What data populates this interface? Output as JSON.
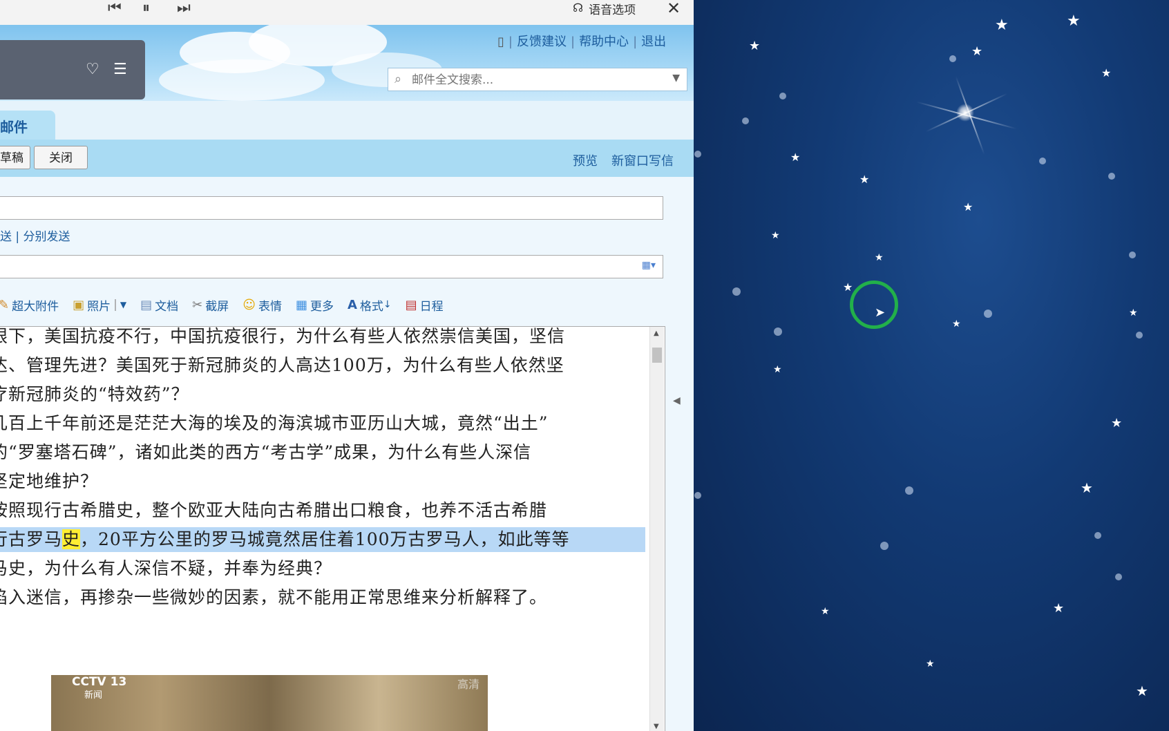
{
  "voicebar": {
    "prev_icon": "skip-back-icon",
    "pause_icon": "pause-icon",
    "next_icon": "skip-forward-icon",
    "voice_options_label": "语音选项",
    "close_icon": "close-icon"
  },
  "header": {
    "links": [
      "反馈建议",
      "帮助中心",
      "退出"
    ],
    "search_placeholder": "邮件全文搜索..."
  },
  "tab": {
    "label": "邮件"
  },
  "toolbar": {
    "save_draft_label": "草稿",
    "close_label": "关闭",
    "preview_label": "预览",
    "new_window_label": "新窗口写信"
  },
  "compose": {
    "send_options": "送 | 分别发送",
    "attachments": [
      {
        "icon": "paperclip-icon",
        "label": "超大附件"
      },
      {
        "icon": "photo-icon",
        "label": "照片"
      },
      {
        "icon": "document-icon",
        "label": "文档"
      },
      {
        "icon": "scissors-icon",
        "label": "截屏"
      },
      {
        "icon": "smile-icon",
        "label": "表情"
      },
      {
        "icon": "grid-icon",
        "label": "更多"
      },
      {
        "icon": "format-icon",
        "label": "格式"
      },
      {
        "icon": "calendar-icon",
        "label": "日程"
      }
    ],
    "body_lines": [
      "眼下，美国抗疫不行，中国抗疫很行，为什么有些人依然崇信美国，坚信",
      "达、管理先进？美国死于新冠肺炎的人高达100万，为什么有些人依然坚",
      "疗新冠肺炎的“特效药”？",
      "几百上千年前还是茫茫大海的埃及的海滨城市亚历山大城，竟然“出土”",
      "的“罗塞塔石碑”，诸如此类的西方“考古学”成果，为什么有些人深信",
      "坚定地维护？",
      "按照现行古希腊史，整个欧亚大陆向古希腊出口粮食，也养不活古希腊",
      "马史，为什么有人深信不疑，并奉为经典？",
      "陷入迷信，再掺杂一些微妙的因素，就不能用正常思维来分析解释了。"
    ],
    "highlight_line_pre": "行古罗马",
    "highlight_word": "史",
    "highlight_line_post": "，20平方公里的罗马城竟然居住着100万古罗马人，如此等等",
    "video_logo": "CCTV 13",
    "video_sub": "新闻",
    "video_quality": "高清"
  }
}
